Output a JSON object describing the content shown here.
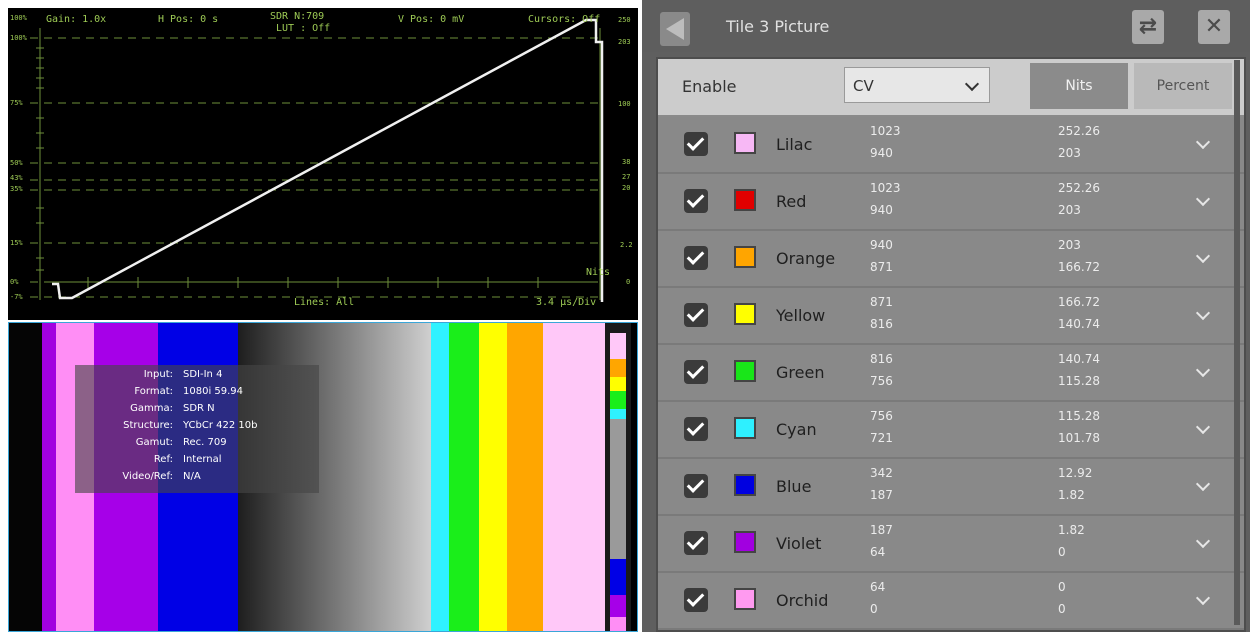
{
  "waveform": {
    "header": {
      "gain": "Gain: 1.0x",
      "h_pos": "H Pos: 0 s",
      "sdr": "SDR N:709",
      "lut": "LUT : Off",
      "v_pos": "V Pos: 0 mV",
      "cursors": "Cursors: Off"
    },
    "footer": {
      "lines": "Lines: All",
      "time_div": "3.4 µs/Div",
      "nits_label": "Nits"
    },
    "left_scale": [
      "100%",
      "100%",
      "75%",
      "50%",
      "43%",
      "35%",
      "15%",
      "0%",
      "-7%"
    ],
    "right_scale": [
      "250",
      "203",
      "100",
      "38",
      "27",
      "20",
      "2.2",
      "0"
    ]
  },
  "picture": {
    "info": [
      {
        "key": "Input:",
        "value": "SDI-In 4"
      },
      {
        "key": "Format:",
        "value": "1080i 59.94"
      },
      {
        "key": "Gamma:",
        "value": "SDR N"
      },
      {
        "key": "Structure:",
        "value": "YCbCr 422 10b"
      },
      {
        "key": "Gamut:",
        "value": "Rec. 709"
      },
      {
        "key": "Ref:",
        "value": "Internal"
      },
      {
        "key": "Video/Ref:",
        "value": "N/A"
      }
    ]
  },
  "panel": {
    "title": "Tile 3 Picture",
    "enable_label": "Enable",
    "select_value": "CV",
    "nits_label": "Nits",
    "percent_label": "Percent",
    "colors": [
      {
        "name": "Lilac",
        "cv_top": "1023",
        "cv_bottom": "940",
        "nits_top": "252.26",
        "nits_bottom": "203",
        "swatch": "#f7b8f5"
      },
      {
        "name": "Red",
        "cv_top": "1023",
        "cv_bottom": "940",
        "nits_top": "252.26",
        "nits_bottom": "203",
        "swatch": "#e10000"
      },
      {
        "name": "Orange",
        "cv_top": "940",
        "cv_bottom": "871",
        "nits_top": "203",
        "nits_bottom": "166.72",
        "swatch": "#ffa500"
      },
      {
        "name": "Yellow",
        "cv_top": "871",
        "cv_bottom": "816",
        "nits_top": "166.72",
        "nits_bottom": "140.74",
        "swatch": "#ffff00"
      },
      {
        "name": "Green",
        "cv_top": "816",
        "cv_bottom": "756",
        "nits_top": "140.74",
        "nits_bottom": "115.28",
        "swatch": "#19e619"
      },
      {
        "name": "Cyan",
        "cv_top": "756",
        "cv_bottom": "721",
        "nits_top": "115.28",
        "nits_bottom": "101.78",
        "swatch": "#2ef0ff"
      },
      {
        "name": "Blue",
        "cv_top": "342",
        "cv_bottom": "187",
        "nits_top": "12.92",
        "nits_bottom": "1.82",
        "swatch": "#0000e0"
      },
      {
        "name": "Violet",
        "cv_top": "187",
        "cv_bottom": "64",
        "nits_top": "1.82",
        "nits_bottom": "0",
        "swatch": "#a100e0"
      },
      {
        "name": "Orchid",
        "cv_top": "64",
        "cv_bottom": "0",
        "nits_top": "0",
        "nits_bottom": "0",
        "swatch": "#ff9af0"
      }
    ]
  }
}
